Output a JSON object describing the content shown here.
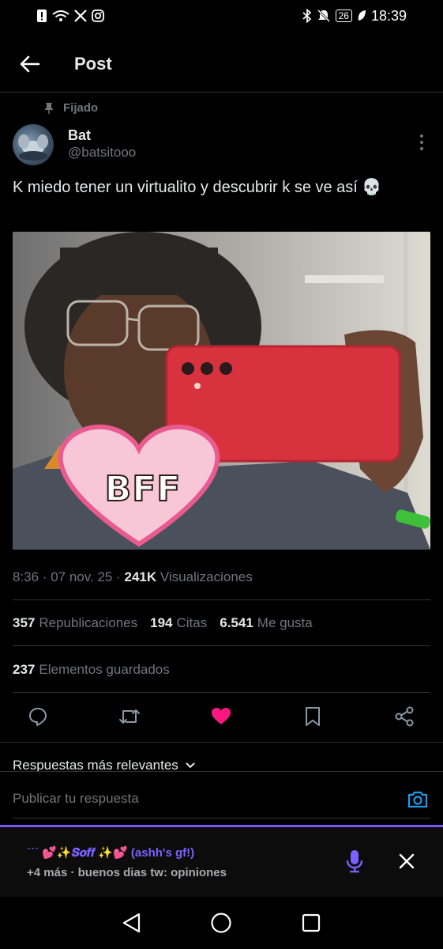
{
  "status_bar": {
    "time": "18:39",
    "battery": "26",
    "left_icons": [
      "alert-icon",
      "wifi-icon",
      "x-logo-icon",
      "instagram-icon"
    ],
    "right_icons": [
      "bluetooth-icon",
      "mute-icon",
      "battery-icon",
      "leaf-icon"
    ]
  },
  "header": {
    "title": "Post"
  },
  "pinned": {
    "label": "Fijado"
  },
  "author": {
    "name": "Bat",
    "handle": "@batsitooo"
  },
  "tweet": {
    "text": "K miedo tener un virtualito y descubrir k se ve así 💀",
    "sticker_text": "BFF"
  },
  "meta": {
    "time": "8:36",
    "date": "07 nov. 25",
    "views_count": "241K",
    "views_label": "Visualizaciones"
  },
  "stats": {
    "reposts_count": "357",
    "reposts_label": "Republicaciones",
    "quotes_count": "194",
    "quotes_label": "Citas",
    "likes_count": "6.541",
    "likes_label": "Me gusta",
    "saved_count": "237",
    "saved_label": "Elementos guardados"
  },
  "actions": [
    "reply-icon",
    "repost-icon",
    "like-icon",
    "bookmark-icon",
    "share-icon"
  ],
  "replies_sort": {
    "label": "Respuestas más relevantes"
  },
  "reply": {
    "placeholder": "Publicar tu respuesta"
  },
  "space": {
    "title": "˙˙˙ 💕✨𝑺𝒐𝒇𝒇 ✨💕 (ashh's gf!)",
    "subtitle": "+4 más · buenos dias  tw: opiniones"
  },
  "colors": {
    "background": "#000000",
    "like_pink": "#f91880",
    "accent_blue": "#1d9bf0",
    "space_purple": "#7856ff"
  }
}
